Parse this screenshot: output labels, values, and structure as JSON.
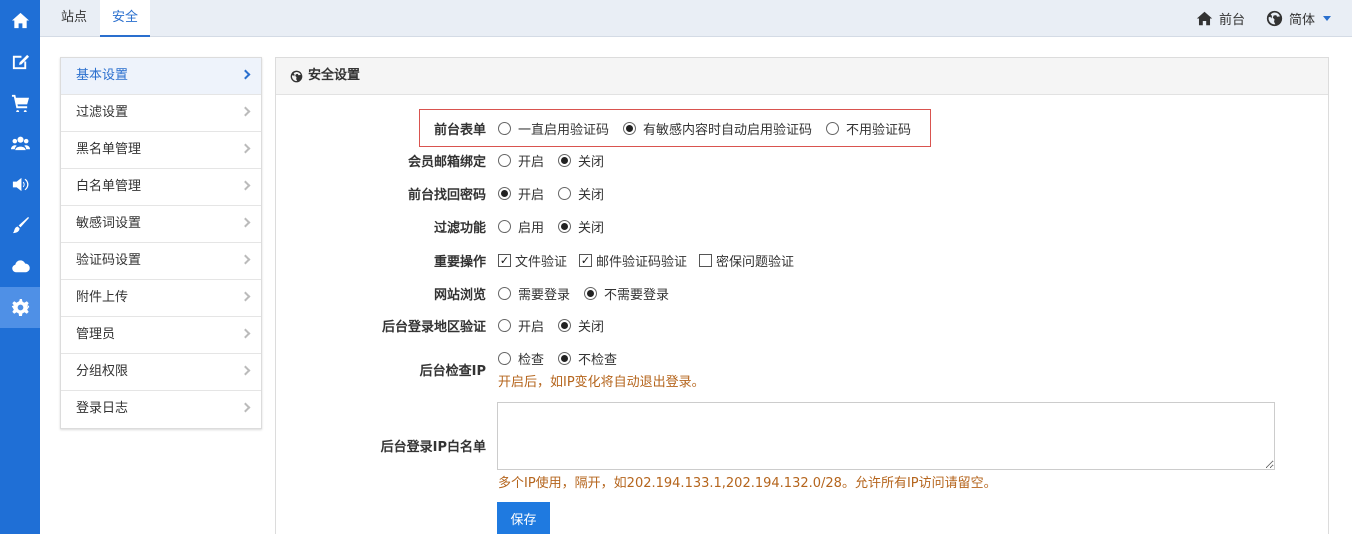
{
  "topbar": {
    "tabs": [
      {
        "label": "站点"
      },
      {
        "label": "安全"
      }
    ],
    "frontend_label": "前台",
    "language_label": "简体"
  },
  "rail": {
    "icons": [
      "home-icon",
      "edit-icon",
      "cart-icon",
      "users-icon",
      "megaphone-icon",
      "brush-icon",
      "cloud-icon",
      "gear-icon"
    ],
    "active_index": 7
  },
  "sidebar": {
    "items": [
      {
        "label": "基本设置"
      },
      {
        "label": "过滤设置"
      },
      {
        "label": "黑名单管理"
      },
      {
        "label": "白名单管理"
      },
      {
        "label": "敏感词设置"
      },
      {
        "label": "验证码设置"
      },
      {
        "label": "附件上传"
      },
      {
        "label": "管理员"
      },
      {
        "label": "分组权限"
      },
      {
        "label": "登录日志"
      }
    ],
    "active_index": 0
  },
  "panel": {
    "title": "安全设置",
    "rows": {
      "front_form": {
        "label": "前台表单",
        "options": [
          "一直启用验证码",
          "有敏感内容时自动启用验证码",
          "不用验证码"
        ],
        "selected": 1
      },
      "email_bind": {
        "label": "会员邮箱绑定",
        "options": [
          "开启",
          "关闭"
        ],
        "selected": 1
      },
      "find_password": {
        "label": "前台找回密码",
        "options": [
          "开启",
          "关闭"
        ],
        "selected": 0
      },
      "filter": {
        "label": "过滤功能",
        "options": [
          "启用",
          "关闭"
        ],
        "selected": 1
      },
      "important_ops": {
        "label": "重要操作",
        "options": [
          "文件验证",
          "邮件验证码验证",
          "密保问题验证"
        ],
        "checked": [
          true,
          true,
          false
        ]
      },
      "site_browse": {
        "label": "网站浏览",
        "options": [
          "需要登录",
          "不需要登录"
        ],
        "selected": 1
      },
      "admin_region": {
        "label": "后台登录地区验证",
        "options": [
          "开启",
          "关闭"
        ],
        "selected": 1
      },
      "admin_ip_check": {
        "label": "后台检查IP",
        "options": [
          "检查",
          "不检查"
        ],
        "selected": 1,
        "hint": "开启后，如IP变化将自动退出登录。"
      },
      "ip_whitelist": {
        "label": "后台登录IP白名单",
        "value": "",
        "hint": "多个IP使用，隔开，如202.194.133.1,202.194.132.0/28。允许所有IP访问请留空。"
      }
    },
    "save_label": "保存"
  },
  "colors": {
    "rail": "#1f6fd6",
    "accent": "#2a6fce",
    "highlight_border": "#d9534f",
    "hint": "#b5651d",
    "button": "#1f7ae0"
  }
}
